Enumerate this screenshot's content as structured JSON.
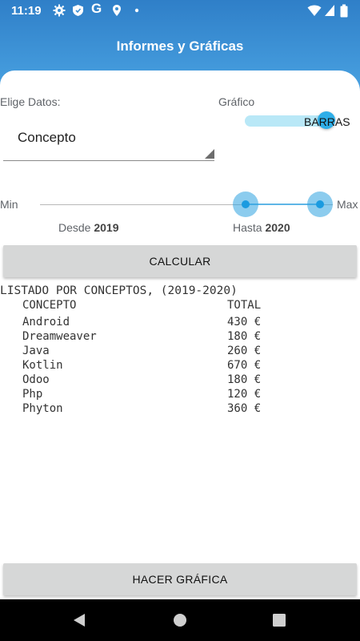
{
  "status_bar": {
    "time": "11:19",
    "left_icons": [
      "settings-icon",
      "shield-icon",
      "google-icon",
      "location-icon",
      "dot-icon"
    ],
    "right_icons": [
      "wifi-icon",
      "signal-icon",
      "battery-icon"
    ]
  },
  "app_bar": {
    "title": "Informes y Gráficas"
  },
  "data_section": {
    "label": "Elige Datos:",
    "spinner_value": "Concepto"
  },
  "chart_section": {
    "label": "Gráfico",
    "switch_text": "BARRAS"
  },
  "range": {
    "min_label": "Min",
    "max_label": "Max",
    "from_prefix": "Desde",
    "from_value": "2019",
    "to_prefix": "Hasta",
    "to_value": "2020"
  },
  "calc_button": "CALCULAR",
  "report": {
    "heading": "LISTADO POR CONCEPTOS, (2019-2020)",
    "col_concept": "CONCEPTO",
    "col_total": "TOTAL",
    "rows": [
      {
        "concept": "Android",
        "total": "430 €"
      },
      {
        "concept": "Dreamweaver",
        "total": "180 €"
      },
      {
        "concept": "Java",
        "total": "260 €"
      },
      {
        "concept": "Kotlin",
        "total": "670 €"
      },
      {
        "concept": "Odoo",
        "total": "180 €"
      },
      {
        "concept": "Php",
        "total": "120 €"
      },
      {
        "concept": "Phyton",
        "total": "360 €"
      }
    ]
  },
  "chart_button": "HACER GRÁFICA",
  "nav_bar": {
    "icons": [
      "back-icon",
      "home-icon",
      "recents-icon"
    ]
  },
  "colors": {
    "primary": "#2f7fc8",
    "accent": "#2eaee8",
    "button": "#d6d7d7"
  }
}
